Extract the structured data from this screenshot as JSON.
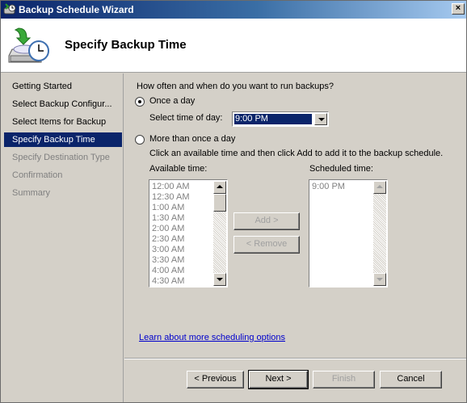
{
  "window": {
    "title": "Backup Schedule Wizard",
    "close_glyph": "×",
    "app_icon": "backup-wizard-icon"
  },
  "header": {
    "title": "Specify Backup Time",
    "icon": "backup-clock-icon"
  },
  "sidebar": {
    "steps": [
      {
        "label": "Getting Started",
        "state": "done"
      },
      {
        "label": "Select Backup Configur...",
        "state": "done"
      },
      {
        "label": "Select Items for Backup",
        "state": "done"
      },
      {
        "label": "Specify Backup Time",
        "state": "active"
      },
      {
        "label": "Specify Destination Type",
        "state": "pending"
      },
      {
        "label": "Confirmation",
        "state": "pending"
      },
      {
        "label": "Summary",
        "state": "pending"
      }
    ]
  },
  "main": {
    "question": "How often and when do you want to run backups?",
    "once_a_day": {
      "label": "Once a day",
      "selected": true,
      "time_label": "Select time of day:",
      "time_value": "9:00 PM"
    },
    "more_than_once": {
      "label": "More than once a day",
      "selected": false,
      "instruction": "Click an available time and then click Add to add it to the backup schedule.",
      "available_label": "Available time:",
      "available_times": [
        "12:00 AM",
        "12:30 AM",
        "1:00 AM",
        "1:30 AM",
        "2:00 AM",
        "2:30 AM",
        "3:00 AM",
        "3:30 AM",
        "4:00 AM",
        "4:30 AM"
      ],
      "scheduled_label": "Scheduled time:",
      "scheduled_times": [
        "9:00 PM"
      ],
      "add_button": "Add >",
      "remove_button": "< Remove"
    },
    "learn_more_link": "Learn about more scheduling options"
  },
  "buttons": {
    "previous": "< Previous",
    "next": "Next >",
    "finish": "Finish",
    "cancel": "Cancel"
  },
  "colors": {
    "selection": "#0a246a",
    "link": "#0000cc",
    "face": "#d4d0c8"
  }
}
